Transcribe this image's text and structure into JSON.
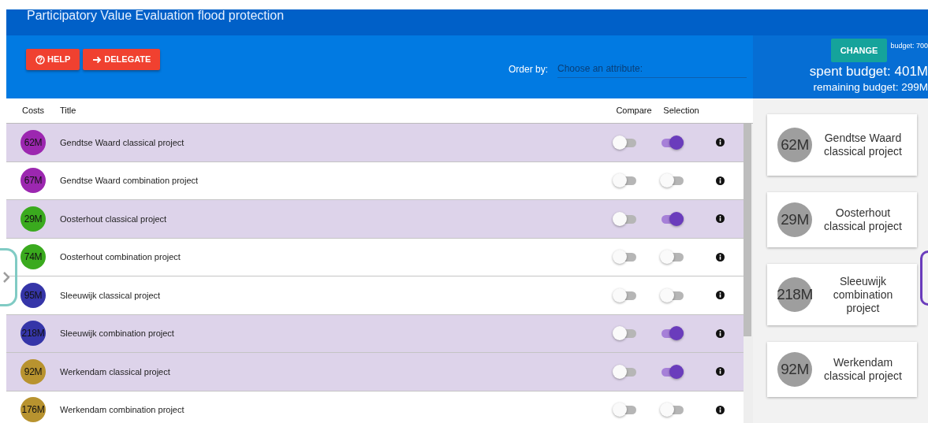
{
  "window": {
    "title": "Participatory Value Evaluation flood protection"
  },
  "toolbar": {
    "buttons": [
      {
        "kind": "help",
        "label": "HELP"
      },
      {
        "kind": "delegate",
        "label": "DELEGATE"
      }
    ],
    "order_by": {
      "label": "Order by:",
      "placeholder": "Choose an attribute:"
    }
  },
  "budget_panel": {
    "button": "CHANGE",
    "budget": "budget: 700",
    "spent": "spent budget: 401M",
    "remaining": "remaining budget: 299M"
  },
  "table": {
    "columns": [
      "Costs",
      "Title",
      "Compare",
      "Selection"
    ],
    "rows": [
      {
        "cost": "62M",
        "color": "#9c27b0",
        "title": "Gendtse Waard classical project",
        "compare": false,
        "selected": true
      },
      {
        "cost": "67M",
        "color": "#9c27b0",
        "title": "Gendtse Waard combination project",
        "compare": false,
        "selected": false
      },
      {
        "cost": "29M",
        "color": "#3aaa1e",
        "title": "Oosterhout classical project",
        "compare": false,
        "selected": true
      },
      {
        "cost": "74M",
        "color": "#3aaa1e",
        "title": "Oosterhout combination project",
        "compare": false,
        "selected": false
      },
      {
        "cost": "95M",
        "color": "#3535a8",
        "title": "Sleeuwijk classical project",
        "compare": false,
        "selected": false
      },
      {
        "cost": "218M",
        "color": "#3535a8",
        "title": "Sleeuwijk combination project",
        "compare": false,
        "selected": true
      },
      {
        "cost": "92M",
        "color": "#b8932f",
        "title": "Werkendam classical project",
        "compare": false,
        "selected": true
      },
      {
        "cost": "176M",
        "color": "#b8932f",
        "title": "Werkendam combination project",
        "compare": false,
        "selected": false
      }
    ]
  },
  "selection_cards": [
    {
      "cost": "62M",
      "title": "Gendtse Waard classical project"
    },
    {
      "cost": "29M",
      "title": "Oosterhout classical project"
    },
    {
      "cost": "218M",
      "title": "Sleeuwijk combination project"
    },
    {
      "cost": "92M",
      "title": "Werkendam classical project"
    }
  ]
}
